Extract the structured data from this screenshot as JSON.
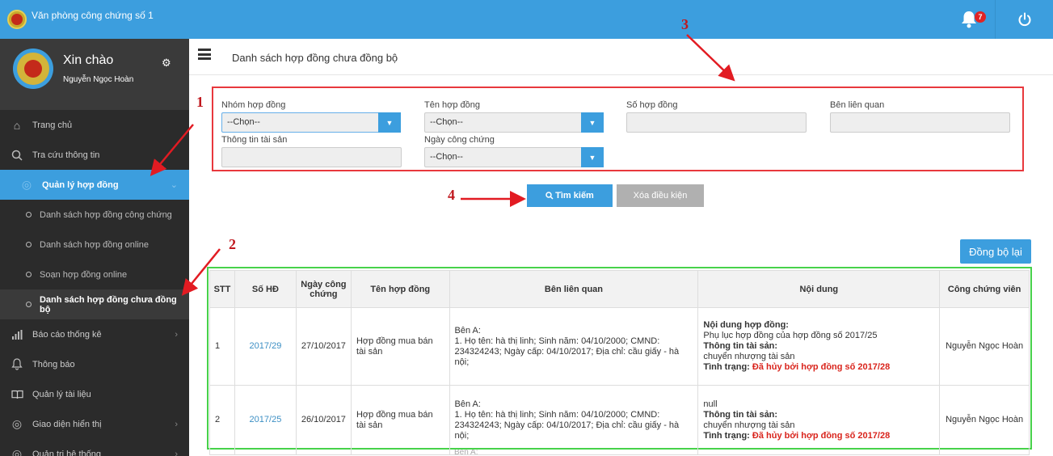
{
  "app": {
    "title": "Văn phòng công chứng số 1",
    "notification_count": "7"
  },
  "sidebar": {
    "greeting": "Xin chào",
    "user_name": "Nguyễn Ngọc Hoàn",
    "items": [
      {
        "label": "Trang chủ",
        "icon": "home-icon"
      },
      {
        "label": "Tra cứu thông tin",
        "icon": "search-icon"
      },
      {
        "label": "Quản lý hợp đồng",
        "icon": "contract-icon"
      },
      {
        "label": "Danh sách hợp đồng công chứng"
      },
      {
        "label": "Danh sách hợp đồng online"
      },
      {
        "label": "Soạn hợp đồng online"
      },
      {
        "label": "Danh sách hợp đồng chưa đồng bộ"
      },
      {
        "label": "Báo cáo thống kê",
        "icon": "chart-icon"
      },
      {
        "label": "Thông báo",
        "icon": "bell-icon"
      },
      {
        "label": "Quản lý tài liệu",
        "icon": "book-icon"
      },
      {
        "label": "Giao diện hiển thị",
        "icon": "settings-icon"
      },
      {
        "label": "Quản trị hệ thống",
        "icon": "settings-icon"
      }
    ]
  },
  "page": {
    "title": "Danh sách hợp đồng chưa đồng bộ"
  },
  "filters": {
    "contract_group_label": "Nhóm hợp đồng",
    "contract_group_value": "--Chọn--",
    "contract_name_label": "Tên hợp đồng",
    "contract_name_value": "--Chọn--",
    "contract_number_label": "Số hợp đồng",
    "related_party_label": "Bên liên quan",
    "asset_info_label": "Thông tin tài sản",
    "notary_date_label": "Ngày công chứng",
    "notary_date_value": "--Chọn--"
  },
  "buttons": {
    "search": "Tìm kiếm",
    "clear": "Xóa điều kiện",
    "resync": "Đồng bộ lại"
  },
  "table": {
    "headers": [
      "STT",
      "Số HĐ",
      "Ngày công chứng",
      "Tên hợp đồng",
      "Bên liên quan",
      "Nội dung",
      "Công chứng viên"
    ],
    "rows": [
      {
        "stt": "1",
        "so_hd": "2017/29",
        "ngay": "27/10/2017",
        "ten": "Hợp đồng mua bán tài sản",
        "ben_a": "Bên A:",
        "ben_detail": "1. Họ tên: hà thị linh; Sinh năm: 04/10/2000; CMND: 234324243; Ngày cấp: 04/10/2017; Địa chỉ: cầu giấy - hà nội;",
        "nd_title": "Nội dung hợp đồng:",
        "nd_text": "Phụ lục hợp đồng của hợp đồng số 2017/25",
        "ts_title": "Thông tin tài sản:",
        "ts_text": "chuyển nhượng tài sản",
        "tt_title": "Tình trạng:",
        "tt_text": "Đã hủy bởi hợp đồng số 2017/28",
        "ccv": "Nguyễn Ngọc Hoàn"
      },
      {
        "stt": "2",
        "so_hd": "2017/25",
        "ngay": "26/10/2017",
        "ten": "Hợp đồng mua bán tài sản",
        "ben_a": "Bên A:",
        "ben_detail": "1. Họ tên: hà thị linh; Sinh năm: 04/10/2000; CMND: 234324243; Ngày cấp: 04/10/2017; Địa chỉ: cầu giấy - hà nội;",
        "nd_title": "null",
        "ts_title": "Thông tin tài sản:",
        "ts_text": "chuyển nhượng tài sản",
        "tt_title": "Tình trạng:",
        "tt_text": "Đã hủy bởi hợp đồng số 2017/28",
        "ccv": "Nguyễn Ngọc Hoàn"
      }
    ],
    "next_row_partial": "Bên A:"
  },
  "annotations": {
    "n1": "1",
    "n2": "2",
    "n3": "3",
    "n4": "4"
  },
  "colors": {
    "primary": "#3c9ede",
    "sidebar": "#2b2b2b",
    "red_box": "#e8383d",
    "green_box": "#47d24a"
  }
}
